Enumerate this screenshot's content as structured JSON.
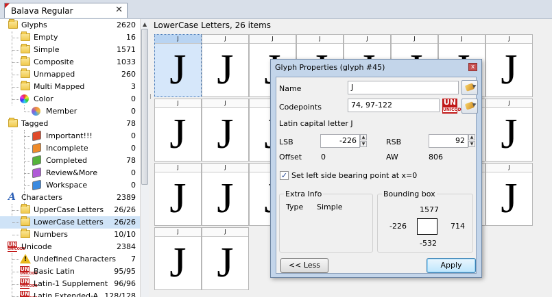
{
  "tab": {
    "title": "Balava Regular",
    "close": "✕"
  },
  "tree": {
    "glyphs": {
      "label": "Glyphs",
      "count": "2620"
    },
    "empty": {
      "label": "Empty",
      "count": "16"
    },
    "simple": {
      "label": "Simple",
      "count": "1571"
    },
    "composite": {
      "label": "Composite",
      "count": "1033"
    },
    "unmapped": {
      "label": "Unmapped",
      "count": "260"
    },
    "multimapped": {
      "label": "Multi Mapped",
      "count": "3"
    },
    "color": {
      "label": "Color",
      "count": "0"
    },
    "member": {
      "label": "Member",
      "count": "0"
    },
    "tagged": {
      "label": "Tagged",
      "count": "78"
    },
    "important": {
      "label": "Important!!!",
      "count": "0"
    },
    "incomplete": {
      "label": "Incomplete",
      "count": "0"
    },
    "completed": {
      "label": "Completed",
      "count": "78"
    },
    "review": {
      "label": "Review&More",
      "count": "0"
    },
    "workspace": {
      "label": "Workspace",
      "count": "0"
    },
    "characters": {
      "label": "Characters",
      "count": "2389"
    },
    "uppercase": {
      "label": "UpperCase Letters",
      "count": "26/26"
    },
    "lowercase": {
      "label": "LowerCase Letters",
      "count": "26/26"
    },
    "numbers": {
      "label": "Numbers",
      "count": "10/10"
    },
    "unicode": {
      "label": "Unicode",
      "count": "2384"
    },
    "undefined": {
      "label": "Undefined Characters",
      "count": "7"
    },
    "basiclatin": {
      "label": "Basic Latin",
      "count": "95/95"
    },
    "latin1": {
      "label": "Latin-1 Supplement",
      "count": "96/96"
    },
    "latinexta": {
      "label": "Latin Extended-A",
      "count": "128/128"
    }
  },
  "grid": {
    "header": "LowerCase Letters, 26 items",
    "cell_label": "J",
    "glyph": "J"
  },
  "dialog": {
    "title": "Glyph Properties (glyph #45)",
    "close": "x",
    "name_label": "Name",
    "name_value": "J",
    "codepoints_label": "Codepoints",
    "codepoints_value": "74, 97-122",
    "description": "Latin capital letter J",
    "lsb_label": "LSB",
    "lsb_value": "-226",
    "rsb_label": "RSB",
    "rsb_value": "92",
    "offset_label": "Offset",
    "offset_value": "0",
    "aw_label": "AW",
    "aw_value": "806",
    "checkbox_label": "Set left side bearing point at x=0",
    "checkbox_checked": true,
    "extra_info_title": "Extra Info",
    "type_label": "Type",
    "type_value": "Simple",
    "bbox_title": "Bounding box",
    "bbox_top": "1577",
    "bbox_left": "-226",
    "bbox_right": "714",
    "bbox_bottom": "-532",
    "less_button": "<< Less",
    "apply_button": "Apply"
  },
  "icons": {
    "unicode_badge_top": "UN",
    "unicode_badge_bottom": "UNICODE",
    "warning": "!",
    "characters_glyph": "A",
    "checkmark": "✓",
    "spin_up": "▲",
    "spin_down": "▼",
    "scroll_up": "▲",
    "grip": "⁞"
  },
  "colors": {
    "selection": "#cfe3f7",
    "tag_important": "#e04a2a",
    "tag_incomplete": "#ee8a2a",
    "tag_completed": "#55b33a",
    "tag_review": "#b05ad8",
    "tag_workspace": "#3a8ae0"
  }
}
